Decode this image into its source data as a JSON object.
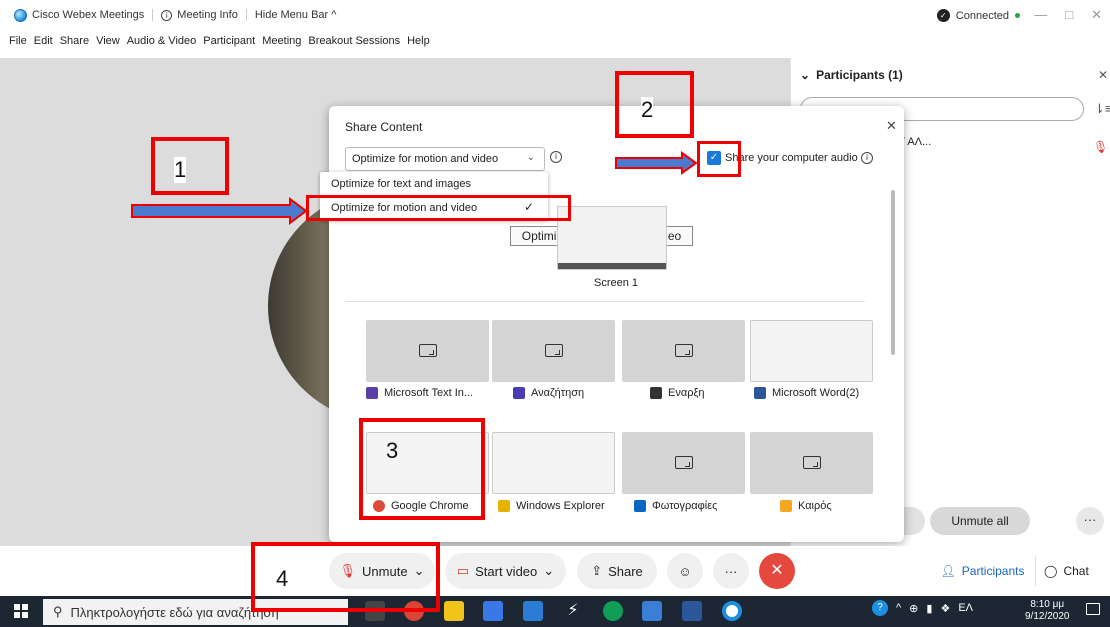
{
  "titlebar": {
    "app_name": "Cisco Webex Meetings",
    "meeting_info": "Meeting Info",
    "hide_menu": "Hide Menu Bar ^",
    "connected": "Connected"
  },
  "menu": [
    "File",
    "Edit",
    "Share",
    "View",
    "Audio & Video",
    "Participant",
    "Meeting",
    "Breakout Sessions",
    "Help"
  ],
  "participants_panel": {
    "title": "Participants (1)",
    "name": "ΥΛΟΥ ΑΛ...",
    "unmute_all": "Unmute all"
  },
  "share_dialog": {
    "title": "Share Content",
    "optimize_selected": "Optimize for motion and video",
    "dropdown_options": [
      "Optimize for text and images",
      "Optimize for motion and video"
    ],
    "tooltip": "Optimize for motion and video",
    "share_audio": "Share your computer audio",
    "screen_label": "Screen 1",
    "apps": [
      {
        "label": "Microsoft Text In...",
        "icon": "text-input-icon",
        "color": "#5a3fa8"
      },
      {
        "label": "Αναζήτηση",
        "icon": "cortana-search-icon",
        "color": "#4b3bb0"
      },
      {
        "label": "Εναρξη",
        "icon": "start-icon",
        "color": "#333333"
      },
      {
        "label": "Microsoft Word(2)",
        "icon": "word-icon",
        "color": "#2b579a"
      },
      {
        "label": "Google Chrome",
        "icon": "chrome-icon",
        "color": "#dd4b39"
      },
      {
        "label": "Windows Explorer",
        "icon": "explorer-icon",
        "color": "#e8b300"
      },
      {
        "label": "Φωτογραφίες",
        "icon": "photos-icon",
        "color": "#0a66c2"
      },
      {
        "label": "Καιρός",
        "icon": "weather-icon",
        "color": "#f5a623"
      }
    ]
  },
  "toolbar": {
    "unmute": "Unmute",
    "start_video": "Start video",
    "share": "Share",
    "participants": "Participants",
    "chat": "Chat"
  },
  "taskbar": {
    "search_placeholder": "Πληκτρολογήστε εδώ για αναζήτηση",
    "lang": "ΕΛ",
    "time": "8:10 μμ",
    "date": "9/12/2020"
  },
  "annotations": [
    "1",
    "2",
    "3",
    "4"
  ],
  "colors": {
    "accent": "#1a7ad9",
    "end_call": "#e5483d",
    "annotation_red": "#e00000",
    "arrow_blue": "#4a7bd1"
  }
}
